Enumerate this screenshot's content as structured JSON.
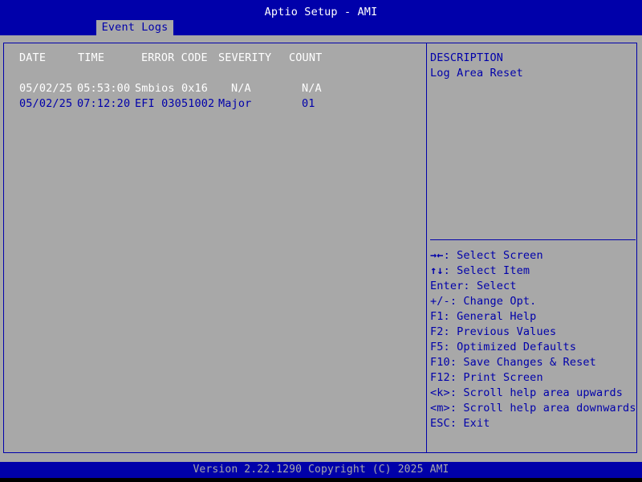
{
  "header": {
    "title": "Aptio Setup - AMI",
    "tab": "Event Logs"
  },
  "columns": {
    "date": "DATE",
    "time": "TIME",
    "error_code": "ERROR CODE",
    "severity": "SEVERITY",
    "count": "COUNT"
  },
  "rows": [
    {
      "date": "05/02/25",
      "time": "05:53:00",
      "error_code": "Smbios 0x16",
      "severity": "N/A",
      "count": "N/A"
    },
    {
      "date": "05/02/25",
      "time": "07:12:20",
      "error_code": "EFI 03051002",
      "severity": "Major",
      "count": "01"
    }
  ],
  "description": {
    "heading": "DESCRIPTION",
    "text": "Log Area Reset"
  },
  "help": [
    {
      "key": "→←",
      "text": ": Select Screen"
    },
    {
      "key": "↑↓",
      "text": ": Select Item"
    },
    {
      "key": "",
      "text": "Enter: Select"
    },
    {
      "key": "",
      "text": "+/-: Change Opt."
    },
    {
      "key": "",
      "text": "F1: General Help"
    },
    {
      "key": "",
      "text": "F2: Previous Values"
    },
    {
      "key": "",
      "text": "F5: Optimized Defaults"
    },
    {
      "key": "",
      "text": "F10: Save Changes & Reset"
    },
    {
      "key": "",
      "text": "F12: Print Screen"
    },
    {
      "key": "",
      "text": "<k>: Scroll help area upwards"
    },
    {
      "key": "",
      "text": "<m>: Scroll help area downwards"
    },
    {
      "key": "",
      "text": "ESC: Exit"
    }
  ],
  "footer": {
    "version": "Version 2.22.1290 Copyright (C) 2025 AMI"
  },
  "colors": {
    "bios_blue": "#0000aa",
    "bios_gray": "#a8a8a8",
    "text_white": "#ffffff"
  }
}
